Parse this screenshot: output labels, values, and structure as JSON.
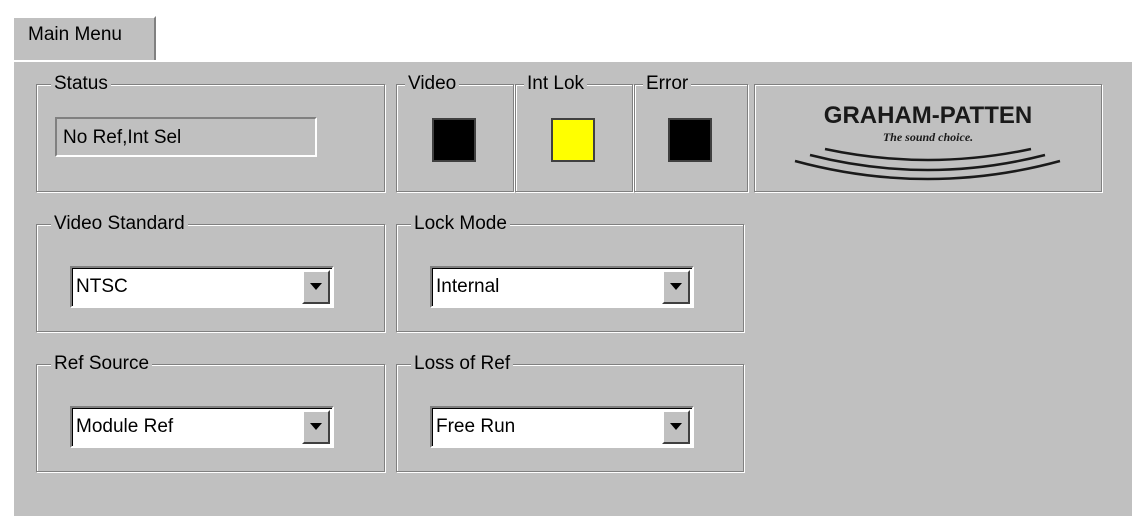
{
  "tab": {
    "label": "Main Menu"
  },
  "status": {
    "legend": "Status",
    "value": "No Ref,Int Sel"
  },
  "indicators": [
    {
      "legend": "Video",
      "color": "#000000"
    },
    {
      "legend": "Int Lok",
      "color": "#ffff00"
    },
    {
      "legend": "Error",
      "color": "#000000"
    }
  ],
  "logo": {
    "brand": "GRAHAM-PATTEN",
    "tagline": "The sound choice."
  },
  "video_standard": {
    "legend": "Video Standard",
    "selected": "NTSC"
  },
  "lock_mode": {
    "legend": "Lock Mode",
    "selected": "Internal"
  },
  "ref_source": {
    "legend": "Ref Source",
    "selected": "Module Ref"
  },
  "loss_of_ref": {
    "legend": "Loss of Ref",
    "selected": "Free Run"
  },
  "colors": {
    "panel": "#c0c0c0",
    "shadow": "#808080",
    "highlight": "#ffffff"
  }
}
